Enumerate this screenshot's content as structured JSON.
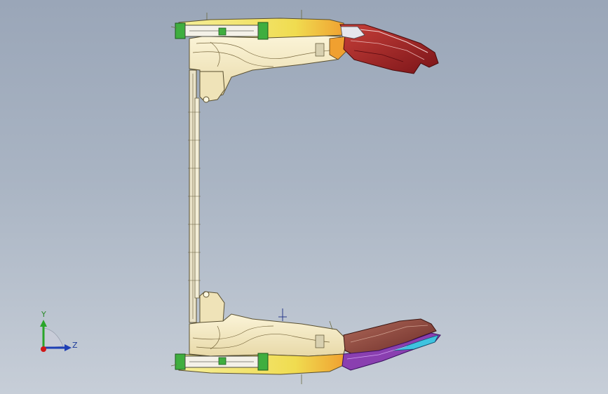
{
  "viewport": {
    "background_top": "#9aa6b8",
    "background_bottom": "#c7ced8"
  },
  "model": {
    "icon": "cad-assembly-icon",
    "colors": {
      "body_cream": "#f3e9c8",
      "body_yellow": "#f2e05a",
      "accent_orange": "#f0a030",
      "green_blocks": "#3fae3f",
      "dark_red": "#a4232a",
      "brown": "#8a4038",
      "purple": "#8a3fb0",
      "cyan": "#3ec3e0",
      "outline": "#5a5030"
    }
  },
  "triad": {
    "y_label": "Y",
    "z_label": "Z",
    "y_color": "#2aa52a",
    "z_color": "#1f3fb5",
    "origin_color": "#d01818"
  }
}
